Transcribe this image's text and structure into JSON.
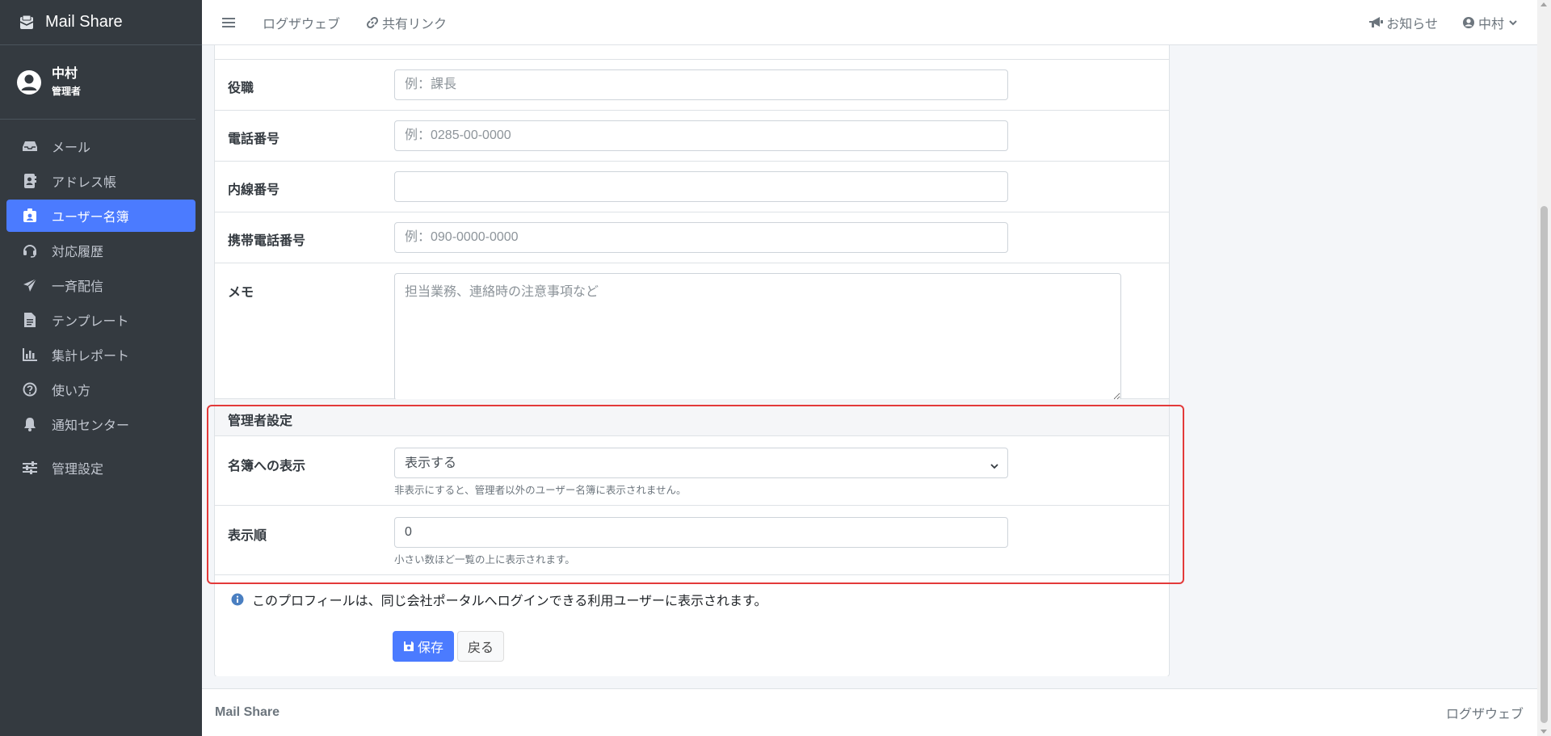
{
  "app": {
    "brand": "Mail Share",
    "brand_icon": "envelope-box-icon"
  },
  "user": {
    "name": "中村",
    "role": "管理者"
  },
  "sidebar": {
    "items": [
      {
        "label": "メール",
        "icon": "inbox-icon"
      },
      {
        "label": "アドレス帳",
        "icon": "address-book-icon"
      },
      {
        "label": "ユーザー名簿",
        "icon": "id-badge-icon",
        "active": true
      },
      {
        "label": "対応履歴",
        "icon": "headset-icon"
      },
      {
        "label": "一斉配信",
        "icon": "paper-plane-icon"
      },
      {
        "label": "テンプレート",
        "icon": "file-icon"
      },
      {
        "label": "集計レポート",
        "icon": "chart-icon"
      },
      {
        "label": "使い方",
        "icon": "question-icon"
      },
      {
        "label": "通知センター",
        "icon": "bell-icon"
      },
      {
        "label": "管理設定",
        "icon": "sliders-icon"
      }
    ]
  },
  "header": {
    "links": [
      {
        "label": "ログザウェブ"
      },
      {
        "label": "共有リンク",
        "icon": "link-icon"
      }
    ],
    "notice": "お知らせ",
    "user_menu": "中村"
  },
  "form": {
    "position": {
      "label": "役職",
      "placeholder": "例：課長",
      "value": ""
    },
    "phone": {
      "label": "電話番号",
      "placeholder": "例：0285-00-0000",
      "value": ""
    },
    "extension": {
      "label": "内線番号",
      "placeholder": "",
      "value": ""
    },
    "mobile": {
      "label": "携帯電話番号",
      "placeholder": "例：090-0000-0000",
      "value": ""
    },
    "memo": {
      "label": "メモ",
      "placeholder": "担当業務、連絡時の注意事項など",
      "value": ""
    }
  },
  "admin": {
    "section_title": "管理者設定",
    "visibility": {
      "label": "名簿への表示",
      "selected": "表示する",
      "help": "非表示にすると、管理者以外のユーザー名簿に表示されません。"
    },
    "order": {
      "label": "表示順",
      "value": "0",
      "help": "小さい数ほど一覧の上に表示されます。"
    }
  },
  "info": "このプロフィールは、同じ会社ポータルへログインできる利用ユーザーに表示されます。",
  "buttons": {
    "save": "保存",
    "back": "戻る"
  },
  "footer": {
    "brand": "Mail Share",
    "right": "ログザウェブ"
  },
  "colors": {
    "primary": "#4b7bff",
    "sidebar": "#343a40",
    "highlight": "#e33a3a"
  }
}
